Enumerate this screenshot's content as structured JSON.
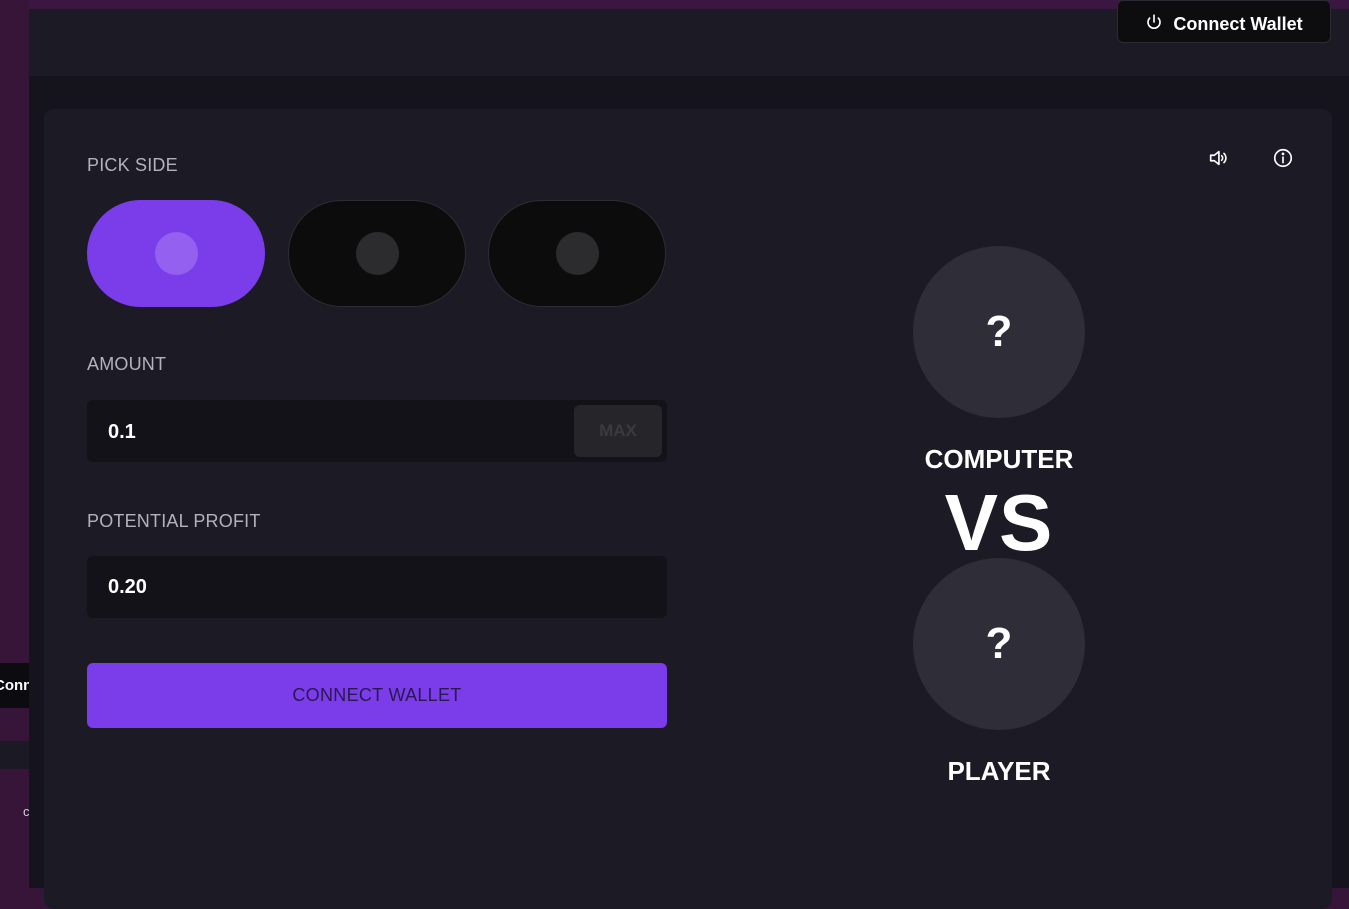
{
  "header": {
    "connect_label": "Connect Wallet"
  },
  "background_fragment": {
    "text": "Conn",
    "glyph": "c"
  },
  "game": {
    "pick_side_label": "PICK SIDE",
    "sides": [
      {
        "state": "selected"
      },
      {
        "state": "unselected"
      },
      {
        "state": "unselected"
      }
    ],
    "amount_label": "AMOUNT",
    "amount_value": "0.1",
    "max_label": "MAX",
    "profit_label": "POTENTIAL PROFIT",
    "profit_value": "0.20",
    "connect_label": "CONNECT WALLET"
  },
  "versus": {
    "computer_symbol": "?",
    "computer_label": "COMPUTER",
    "vs_text": "VS",
    "player_symbol": "?",
    "player_label": "PLAYER"
  },
  "icons": {
    "sound": "speaker-icon",
    "info": "info-icon",
    "power": "power-icon"
  },
  "colors": {
    "accent": "#7b3ce9",
    "background": "#15141d",
    "card": "#1c1b25"
  }
}
